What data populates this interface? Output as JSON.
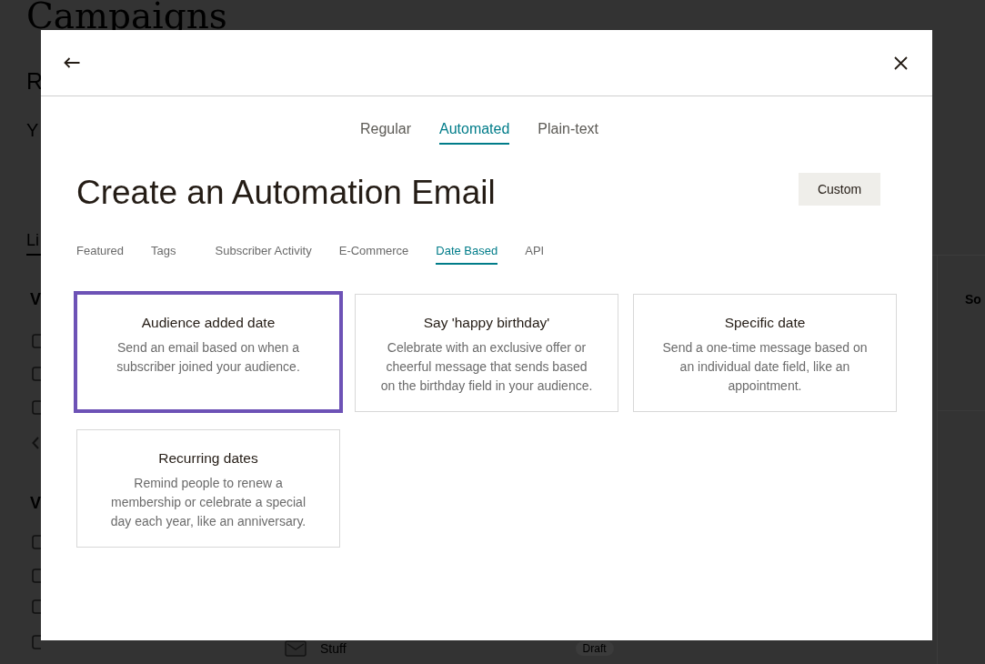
{
  "background_page": {
    "title": "Campaigns",
    "subtitle": "R",
    "intro": "Y",
    "tab": "Li",
    "sections": [
      {
        "heading": "V"
      },
      {
        "heading": "V"
      }
    ],
    "sort_label": "So",
    "campaign": {
      "name": "Stuff",
      "status": "Draft"
    }
  },
  "modal": {
    "type_tabs": [
      {
        "label": "Regular",
        "selected": false
      },
      {
        "label": "Automated",
        "selected": true
      },
      {
        "label": "Plain-text",
        "selected": false
      }
    ],
    "title": "Create an Automation Email",
    "custom_button": "Custom",
    "category_tabs": [
      {
        "label": "Featured",
        "selected": false
      },
      {
        "label": "Tags",
        "selected": false
      },
      {
        "label": "Subscriber Activity",
        "selected": false
      },
      {
        "label": "E-Commerce",
        "selected": false
      },
      {
        "label": "Date Based",
        "selected": true
      },
      {
        "label": "API",
        "selected": false
      }
    ],
    "templates": [
      {
        "title": "Audience added date",
        "description": "Send an email based on when a subscriber joined your audience.",
        "selected": true
      },
      {
        "title": "Say 'happy birthday'",
        "description": "Celebrate with an exclusive offer or cheerful message that sends based on the birthday field in your audience.",
        "selected": false
      },
      {
        "title": "Specific date",
        "description": "Send a one-time message based on an individual date field, like an appointment.",
        "selected": false
      },
      {
        "title": "Recurring dates",
        "description": "Remind people to renew a membership or celebrate a special day each year, like an anniversary.",
        "selected": false
      }
    ]
  }
}
